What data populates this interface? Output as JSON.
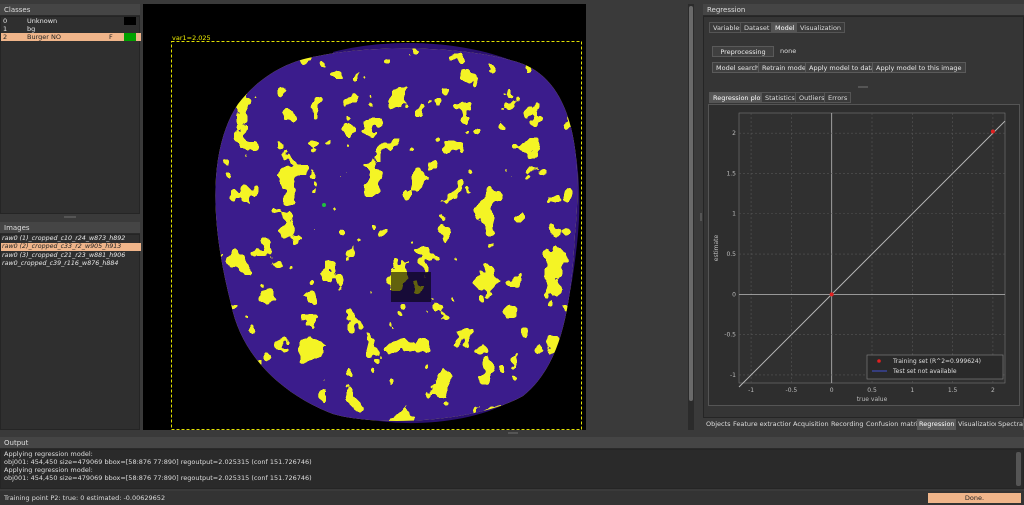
{
  "classes_panel": {
    "title": "Classes",
    "rows": [
      {
        "index": "0",
        "name": "Unknown",
        "key": "",
        "color": "#000000"
      },
      {
        "index": "1",
        "name": "bg",
        "key": "",
        "color": ""
      },
      {
        "index": "2",
        "name": "Burger NO",
        "key": "F",
        "color": "#00a000"
      }
    ]
  },
  "images_panel": {
    "title": "Images",
    "items": [
      "raw0 (1)_cropped_c10_r24_w873_h892",
      "raw0 (2)_cropped_c33_r2_w905_h913",
      "raw0 (3)_cropped_c21_r23_w881_h906",
      "raw0_cropped_c39_r116_w876_h884"
    ],
    "selected_index": 1
  },
  "viewer": {
    "annotation": "var1=2.025"
  },
  "regression_panel": {
    "title": "Regression",
    "top_tabs": [
      "Variables",
      "Dataset",
      "Model",
      "Visualization"
    ],
    "active_top_tab": "Model",
    "preprocessing_button": "Preprocessing",
    "preprocessing_value": "none",
    "actions": [
      "Model search",
      "Retrain model",
      "Apply model to data",
      "Apply model to this image"
    ],
    "plot_tabs": [
      "Regression plot",
      "Statistics",
      "Outliers",
      "Errors"
    ],
    "active_plot_tab": "Regression plot"
  },
  "chart_data": {
    "type": "scatter",
    "xlabel": "true value",
    "ylabel": "estimate",
    "xlim": [
      -1.15,
      2.15
    ],
    "ylim": [
      -1.1,
      2.25
    ],
    "x_ticks": [
      "-1",
      "-0.5",
      "0",
      "0.5",
      "1",
      "1.5",
      "2"
    ],
    "y_ticks": [
      "-1",
      "-0.5",
      "0",
      "0.5",
      "1",
      "1.5",
      "2"
    ],
    "grid": true,
    "legend_placement": "bottom-right",
    "series": [
      {
        "name": "Training set (R^2=0.999624)",
        "points": [
          [
            0,
            0
          ],
          [
            2,
            2.02
          ]
        ],
        "color": "#e02020"
      },
      {
        "name": "Test set not available",
        "points": [],
        "color": "#4050d0"
      }
    ],
    "reference_line": [
      [
        -1.15,
        -1.15
      ],
      [
        2.15,
        2.15
      ]
    ]
  },
  "bottom_tabs": [
    "Objects",
    "Feature extraction",
    "Acquisition",
    "Recording",
    "Confusion matrix",
    "Regression",
    "Visualization",
    "Spectra"
  ],
  "active_bottom_tab": "Regression",
  "output_panel": {
    "title": "Output",
    "lines": [
      "Applying regression model:",
      "obj001: 454,450 size=479069 bbox=[58:876 77:890] regoutput=2.025315 (conf 151.726746)",
      "Applying regression model:",
      "obj001: 454,450 size=479069 bbox=[58:876 77:890] regoutput=2.025315 (conf 151.726746)"
    ]
  },
  "status_bar": {
    "message": "Training point P2: true: 0 estimated: -0.00629652",
    "status": "Done."
  },
  "colors": {
    "selection": "#f0b58a",
    "image_yellow": "#f4f425",
    "image_purple": "#3a1a8c"
  }
}
